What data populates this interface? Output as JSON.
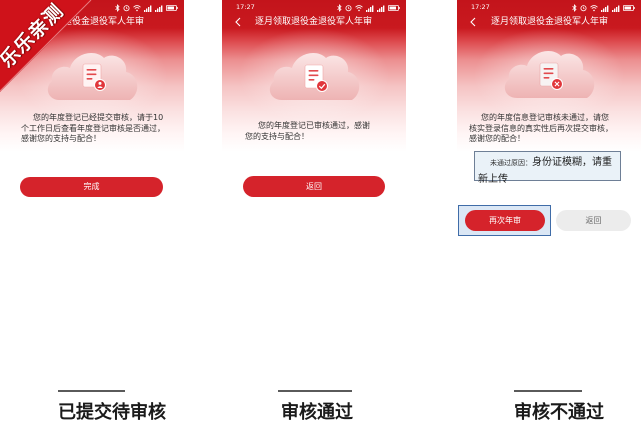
{
  "watermark": "乐乐亲测",
  "panels": [
    {
      "title": "逐月领取退役金退役军人年审",
      "illustration_icon": "document-person-icon",
      "message_lines": [
        "您的年度登记已经提交审核，请于10",
        "个工作日后查看年度登记审核是否通过，",
        "感谢您的支持与配合！"
      ],
      "primary_button": "完成",
      "caption": "已提交待审核"
    },
    {
      "status_time": "17:27",
      "title": "逐月领取退役金退役军人年审",
      "illustration_icon": "document-check-icon",
      "message_lines": [
        "您的年度登记已审核通过，感谢",
        "您的支持与配合！"
      ],
      "primary_button": "返回",
      "caption": "审核通过"
    },
    {
      "status_time": "17:27",
      "title": "逐月领取退役金退役军人年审",
      "illustration_icon": "document-close-icon",
      "message_lines": [
        "您的年度信息登记审核未通过，请您",
        "核实登录信息的真实性后再次提交审核，",
        "感谢您的配合！"
      ],
      "reason_label": "未通过原因：",
      "reason_text": "身份证模糊，请重新上传",
      "primary_button": "再次年审",
      "secondary_button": "返回",
      "caption": "审核不通过"
    }
  ],
  "colors": {
    "header_red": "#c3141b",
    "button_red": "#d5232b",
    "secondary_button_bg": "#ececec",
    "highlight_border": "#3f6ca8",
    "watermark_red": "#cf121a"
  }
}
